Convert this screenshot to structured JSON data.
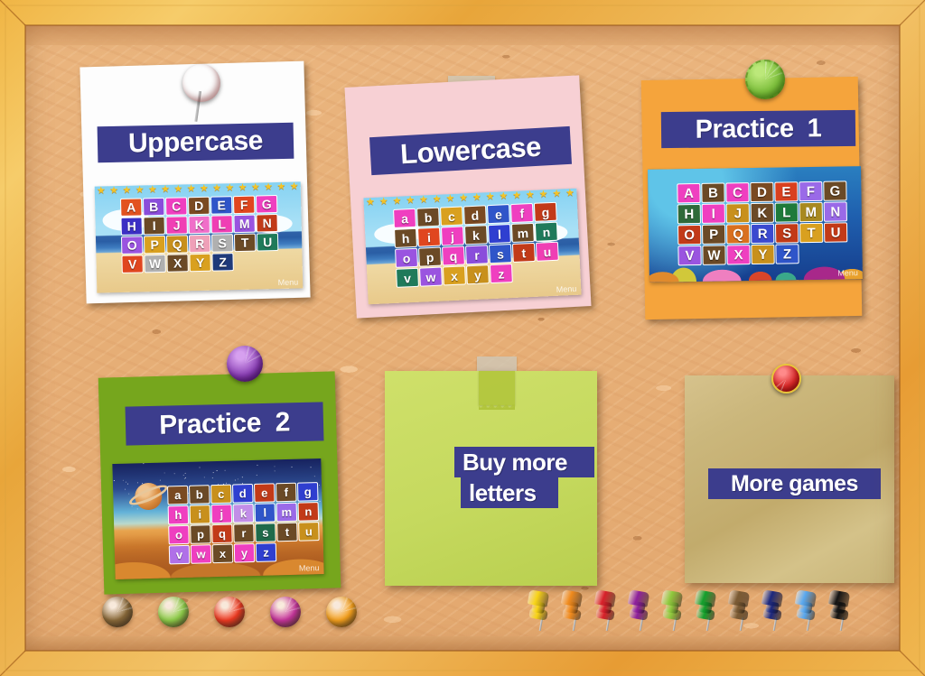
{
  "app": {
    "title": "ABC Alphabet Learning Menu Board",
    "banner_color": "#3c3d8d",
    "banner_text_color": "#ffffff",
    "cork_color": "#e9b27a",
    "frame_color": "#efb44a"
  },
  "cards": [
    {
      "id": "uppercase",
      "title": "Uppercase",
      "paper_color": "#fdfdfd",
      "pin": {
        "type": "round-pin",
        "name": "red-striped-pin",
        "color": "#d93a3a"
      },
      "thumb": {
        "scene": "beach",
        "menu_label": "Menu",
        "case": "upper",
        "rows": [
          [
            "A",
            "B",
            "C",
            "D",
            "E",
            "F",
            "G"
          ],
          [
            "H",
            "I",
            "J",
            "K",
            "L",
            "M",
            "N"
          ],
          [
            "O",
            "P",
            "Q",
            "R",
            "S",
            "T",
            "U"
          ],
          [
            "V",
            "W",
            "X",
            "Y",
            "Z"
          ]
        ],
        "tile_colors": [
          [
            "#e2521f",
            "#8a4ddb",
            "#ef3fc0",
            "#7a4a22",
            "#2f55c9",
            "#e0461f",
            "#ef3fc0"
          ],
          [
            "#3b2fc4",
            "#6b4a26",
            "#f03fb4",
            "#f06ec9",
            "#ef3fb4",
            "#9a54e0",
            "#c23a18"
          ],
          [
            "#9a54e0",
            "#d9a01f",
            "#c8901c",
            "#efa0b8",
            "#b0b0b0",
            "#6b4a26",
            "#1f7a5a"
          ],
          [
            "#e0461f",
            "#b0b0b0",
            "#6b4a26",
            "#d9a01f",
            "#1f3a7a"
          ]
        ]
      }
    },
    {
      "id": "lowercase",
      "title": "Lowercase",
      "paper_color": "#f7d0d4",
      "pin": {
        "type": "tape",
        "name": "adhesive-tape"
      },
      "thumb": {
        "scene": "beach",
        "menu_label": "Menu",
        "case": "lower",
        "rows": [
          [
            "a",
            "b",
            "c",
            "d",
            "e",
            "f",
            "g"
          ],
          [
            "h",
            "i",
            "j",
            "k",
            "l",
            "m",
            "n"
          ],
          [
            "o",
            "p",
            "q",
            "r",
            "s",
            "t",
            "u"
          ],
          [
            "v",
            "w",
            "x",
            "y",
            "z"
          ]
        ],
        "tile_colors": [
          [
            "#ef3fc0",
            "#6b4a26",
            "#d9a01f",
            "#7a4a22",
            "#2f55c9",
            "#ef3fc0",
            "#c23a18"
          ],
          [
            "#6b4a26",
            "#e0461f",
            "#ef3fc0",
            "#6b4a26",
            "#2f3fd0",
            "#6b4a26",
            "#1f7a5a"
          ],
          [
            "#9a54e0",
            "#6b4a26",
            "#ef3fc0",
            "#8a4ddb",
            "#2f55c9",
            "#c23a18",
            "#ef3fb4"
          ],
          [
            "#1f7a5a",
            "#9a54e0",
            "#d9a01f",
            "#c8901c",
            "#ef3fc0"
          ]
        ]
      }
    },
    {
      "id": "practice-1",
      "title": "Practice  1",
      "paper_color": "#f5a43c",
      "pin": {
        "type": "round-pin",
        "name": "green-notched-pin",
        "color": "#7dbf3c"
      },
      "thumb": {
        "scene": "sea",
        "menu_label": "Menu",
        "case": "upper",
        "rows": [
          [
            "A",
            "B",
            "C",
            "D",
            "E",
            "F",
            "G"
          ],
          [
            "H",
            "I",
            "J",
            "K",
            "L",
            "M",
            "N"
          ],
          [
            "O",
            "P",
            "Q",
            "R",
            "S",
            "T",
            "U"
          ],
          [
            "V",
            "W",
            "X",
            "Y",
            "Z"
          ]
        ],
        "tile_colors": [
          [
            "#ef3fc0",
            "#6b4a26",
            "#ef3fc0",
            "#7a4a22",
            "#d9401f",
            "#9a6ae8",
            "#6b4a26"
          ],
          [
            "#2f6a3a",
            "#ef3fc0",
            "#c8901c",
            "#6b4a26",
            "#1f7a3a",
            "#a8891f",
            "#9a6ae8"
          ],
          [
            "#c23a18",
            "#6b4a26",
            "#d9701f",
            "#3b4ad0",
            "#c23a18",
            "#d9a01f",
            "#c23a18"
          ],
          [
            "#9a54e0",
            "#6b4a26",
            "#ef3fc0",
            "#c8901c",
            "#2f55c9"
          ]
        ]
      }
    },
    {
      "id": "practice-2",
      "title": "Practice  2",
      "paper_color": "#76a61d",
      "pin": {
        "type": "round-pin",
        "name": "purple-notched-pin",
        "color": "#8a3fb5"
      },
      "thumb": {
        "scene": "space",
        "menu_label": "Menu",
        "case": "lower",
        "rows": [
          [
            "a",
            "b",
            "c",
            "d",
            "e",
            "f",
            "g"
          ],
          [
            "h",
            "i",
            "j",
            "k",
            "l",
            "m",
            "n"
          ],
          [
            "o",
            "p",
            "q",
            "r",
            "s",
            "t",
            "u"
          ],
          [
            "v",
            "w",
            "x",
            "y",
            "z"
          ]
        ],
        "tile_colors": [
          [
            "#7a4a22",
            "#6b4a26",
            "#c8901c",
            "#2f3fd0",
            "#c23a18",
            "#6b4a26",
            "#2f3fd0"
          ],
          [
            "#ef3fc0",
            "#c8901c",
            "#ef3fc0",
            "#c28ee8",
            "#2f55c9",
            "#9a6ae8",
            "#c23a18"
          ],
          [
            "#ef3fc0",
            "#6b4a26",
            "#c23a18",
            "#6b4a26",
            "#1f6a4a",
            "#6b4a26",
            "#c8901c"
          ],
          [
            "#b070e8",
            "#ef3fc0",
            "#6b4a26",
            "#ef3fc0",
            "#2f3fd0"
          ]
        ]
      }
    }
  ],
  "notes": [
    {
      "id": "buy-more-letters",
      "lines": [
        "Buy more",
        "letters"
      ],
      "color": "#c5d95e",
      "attachment": {
        "type": "tape",
        "name": "adhesive-tape"
      }
    },
    {
      "id": "more-games",
      "lines": [
        "More games"
      ],
      "color": "#c9b478",
      "attachment": {
        "type": "round-pin",
        "name": "red-pin",
        "color": "#d92a2a"
      }
    }
  ],
  "tray": {
    "round_pins": [
      {
        "name": "round-pin-brown",
        "color": "#8a6a3a"
      },
      {
        "name": "round-pin-green",
        "color": "#8ece4a"
      },
      {
        "name": "round-pin-red",
        "color": "#ef3a22"
      },
      {
        "name": "round-pin-magenta",
        "color": "#c6359c"
      },
      {
        "name": "round-pin-orange",
        "color": "#f5a01c"
      }
    ],
    "push_pins": [
      {
        "name": "push-pin-yellow",
        "color": "#f7d316"
      },
      {
        "name": "push-pin-orange",
        "color": "#f08a1c"
      },
      {
        "name": "push-pin-red",
        "color": "#d8202a"
      },
      {
        "name": "push-pin-purple",
        "color": "#8d1f9c"
      },
      {
        "name": "push-pin-light-green",
        "color": "#8ec93c"
      },
      {
        "name": "push-pin-green",
        "color": "#13a02c"
      },
      {
        "name": "push-pin-brown",
        "color": "#7a5a33"
      },
      {
        "name": "push-pin-navy",
        "color": "#1b277e"
      },
      {
        "name": "push-pin-light-blue",
        "color": "#59a8ef"
      },
      {
        "name": "push-pin-black",
        "color": "#131313"
      }
    ]
  }
}
